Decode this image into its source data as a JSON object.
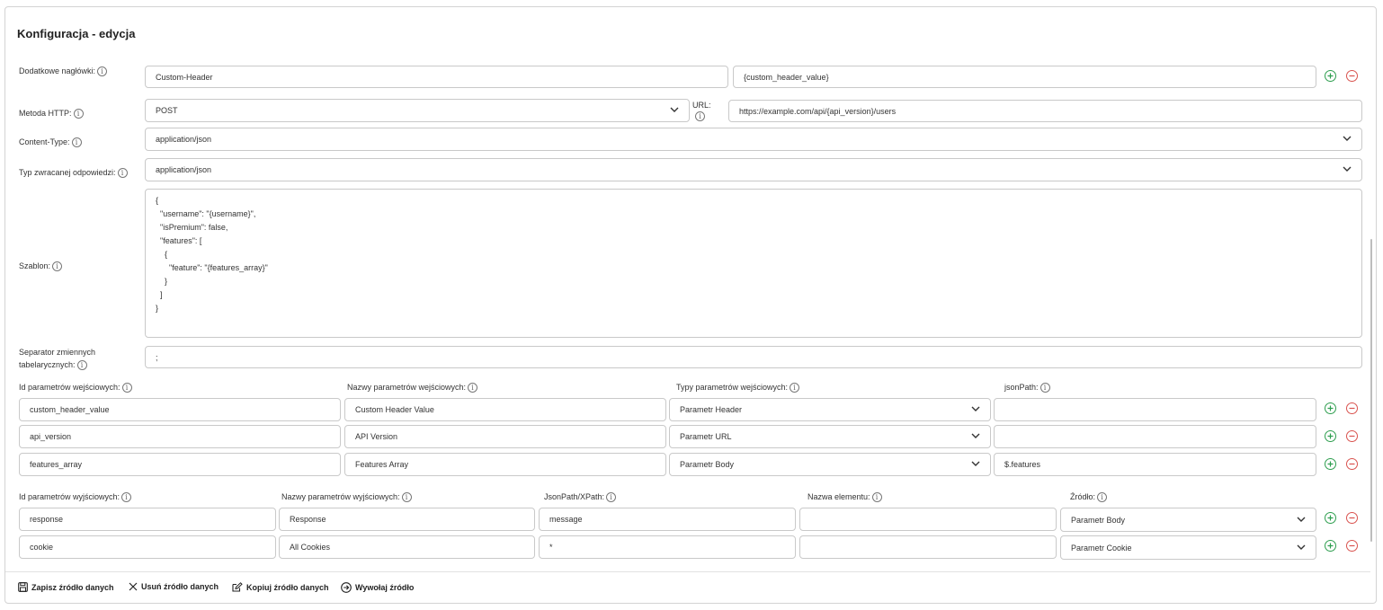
{
  "title": "Konfiguracja - edycja",
  "headers": {
    "label": "Dodatkowe nagłówki:",
    "name_value": "Custom-Header",
    "value_value": "{custom_header_value}"
  },
  "method": {
    "label": "Metoda HTTP:",
    "value": "POST",
    "url_label": "URL:",
    "url_value": "https://example.com/api/{api_version}/users"
  },
  "content_type": {
    "label": "Content-Type:",
    "value": "application/json"
  },
  "response_type": {
    "label": "Typ zwracanej odpowiedzi:",
    "value": "application/json"
  },
  "template": {
    "label": "Szablon:",
    "value": "{\n  \"username\": \"{username}\",\n  \"isPremium\": false,\n  \"features\": [\n    {\n      \"feature\": \"{features_array}\"\n    }\n  ]\n}"
  },
  "separator": {
    "label_line1": "Separator zmiennych",
    "label_line2": "tabelarycznych:",
    "value": ";"
  },
  "input_params": {
    "headers": [
      "Id parametrów wejściowych:",
      "Nazwy parametrów wejściowych:",
      "Typy parametrów wejściowych:",
      "jsonPath:"
    ],
    "rows": [
      {
        "id": "custom_header_value",
        "name": "Custom Header Value",
        "type": "Parametr Header",
        "path": ""
      },
      {
        "id": "api_version",
        "name": "API Version",
        "type": "Parametr URL",
        "path": ""
      },
      {
        "id": "features_array",
        "name": "Features Array",
        "type": "Parametr Body",
        "path": "$.features"
      }
    ]
  },
  "output_params": {
    "headers": [
      "Id parametrów wyjściowych:",
      "Nazwy parametrów wyjściowych:",
      "JsonPath/XPath:",
      "Nazwa elementu:",
      "Źródło:"
    ],
    "rows": [
      {
        "id": "response",
        "name": "Response",
        "path": "message",
        "element": "",
        "source": "Parametr Body"
      },
      {
        "id": "cookie",
        "name": "All Cookies",
        "path": "*",
        "element": "",
        "source": "Parametr Cookie"
      }
    ]
  },
  "actions": {
    "save": "Zapisz źródło danych",
    "delete": "Usuń źródło danych",
    "copy": "Kopiuj źródło danych",
    "invoke": "Wywołaj źródło"
  },
  "colors": {
    "add": "#2e9e4f",
    "remove": "#d9534f",
    "border": "#c9c9c9"
  },
  "icons": {
    "info": "info-icon",
    "add": "plus-circle-icon",
    "remove": "minus-circle-icon",
    "dropdown": "chevron-down-icon"
  }
}
